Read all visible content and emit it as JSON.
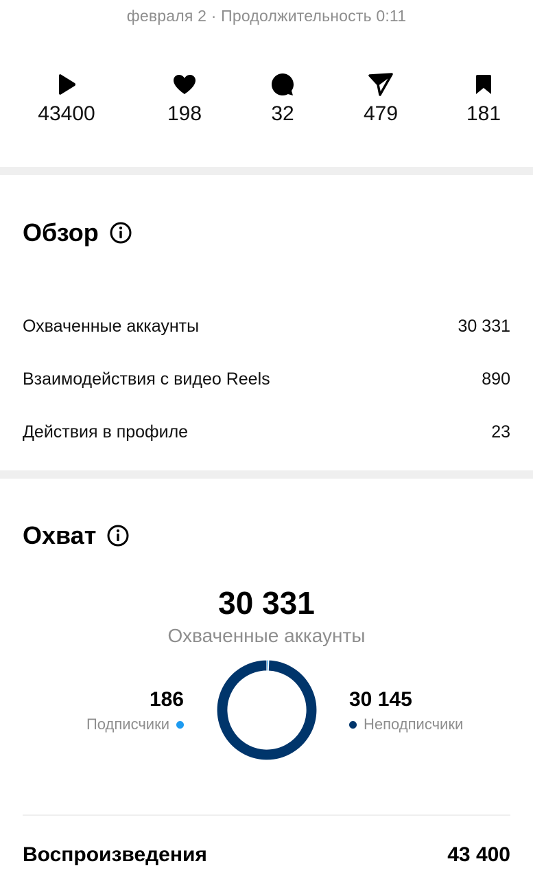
{
  "header": {
    "date_line": "февраля 2 · Продолжительность 0:11"
  },
  "stats": [
    {
      "icon": "play-icon",
      "value": "43400"
    },
    {
      "icon": "heart-icon",
      "value": "198"
    },
    {
      "icon": "comment-icon",
      "value": "32"
    },
    {
      "icon": "send-icon",
      "value": "479"
    },
    {
      "icon": "bookmark-icon",
      "value": "181"
    }
  ],
  "overview": {
    "title": "Обзор",
    "rows": [
      {
        "label": "Охваченные аккаунты",
        "value": "30 331"
      },
      {
        "label": "Взаимодействия с видео Reels",
        "value": "890"
      },
      {
        "label": "Действия в профиле",
        "value": "23"
      }
    ]
  },
  "reach": {
    "title": "Охват",
    "total": "30 331",
    "total_label": "Охваченные аккаунты",
    "followers": {
      "value": "186",
      "label": "Подписчики",
      "color": "#1e9bf0"
    },
    "non_followers": {
      "value": "30 145",
      "label": "Неподписчики",
      "color": "#00356b"
    },
    "chart_data": {
      "type": "pie",
      "categories": [
        "Подписчики",
        "Неподписчики"
      ],
      "values": [
        186,
        30145
      ]
    }
  },
  "plays": {
    "label": "Воспроизведения",
    "value": "43 400"
  }
}
